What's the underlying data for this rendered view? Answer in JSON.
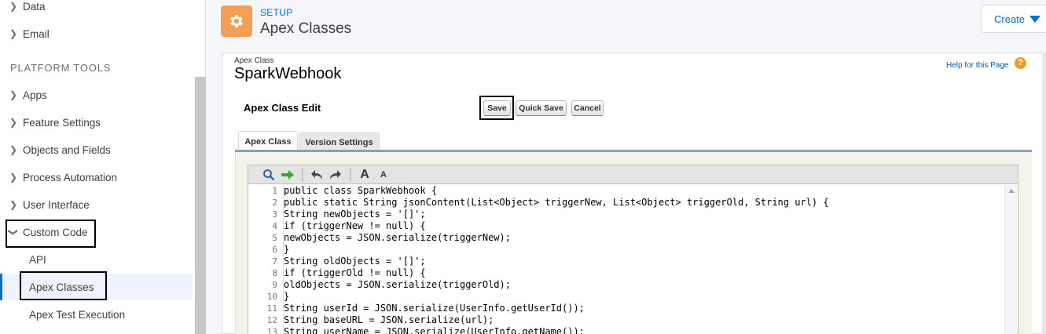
{
  "sidebar": {
    "top_items": [
      {
        "label": "Data"
      },
      {
        "label": "Email"
      }
    ],
    "heading": "PLATFORM TOOLS",
    "items": [
      {
        "label": "Apps"
      },
      {
        "label": "Feature Settings"
      },
      {
        "label": "Objects and Fields"
      },
      {
        "label": "Process Automation"
      },
      {
        "label": "User Interface"
      },
      {
        "label": "Custom Code"
      }
    ],
    "sub_items": [
      {
        "label": "API"
      },
      {
        "label": "Apex Classes"
      },
      {
        "label": "Apex Test Execution"
      }
    ],
    "active_sub": "Apex Classes",
    "icons": {
      "collapsed": "chevron-right-icon",
      "expanded": "chevron-down-icon"
    }
  },
  "header": {
    "breadcrumb": "SETUP",
    "title": "Apex Classes",
    "icon": "gear-icon",
    "icon_color": "#f59e54",
    "create_label": "Create",
    "create_icon": "caret-down-icon"
  },
  "page": {
    "object_label": "Apex Class",
    "class_name": "SparkWebhook",
    "help_link": "Help for this Page",
    "help_icon": "question-circle-icon",
    "edit_title": "Apex Class Edit",
    "buttons": {
      "save": "Save",
      "quick_save": "Quick Save",
      "cancel": "Cancel"
    },
    "tabs": [
      {
        "label": "Apex Class",
        "active": true
      },
      {
        "label": "Version Settings",
        "active": false
      }
    ]
  },
  "editor": {
    "toolbar_icons": [
      "search-icon",
      "go-to-line-icon",
      "undo-icon",
      "redo-icon",
      "font-increase-icon",
      "font-decrease-icon"
    ],
    "toolbar_glyphs": {
      "font_large": "A",
      "font_small": "A"
    },
    "lines": [
      {
        "n": "1",
        "code": "public class SparkWebhook {"
      },
      {
        "n": "2",
        "code": "public static String jsonContent(List<Object> triggerNew, List<Object> triggerOld, String url) {"
      },
      {
        "n": "3",
        "code": "String newObjects = '[]';"
      },
      {
        "n": "4",
        "code": "if (triggerNew != null) {"
      },
      {
        "n": "5",
        "code": "newObjects = JSON.serialize(triggerNew);"
      },
      {
        "n": "6",
        "code": "}"
      },
      {
        "n": "7",
        "code": "String oldObjects = '[]';"
      },
      {
        "n": "8",
        "code": "if (triggerOld != null) {"
      },
      {
        "n": "9",
        "code": "oldObjects = JSON.serialize(triggerOld);"
      },
      {
        "n": "10",
        "code": "}"
      },
      {
        "n": "11",
        "code": "String userId = JSON.serialize(UserInfo.getUserId());"
      },
      {
        "n": "12",
        "code": "String baseURL = JSON.serialize(url);"
      },
      {
        "n": "13",
        "code": "String userName = JSON.serialize(UserInfo.getName());"
      }
    ]
  },
  "colors": {
    "accent": "#0070d2",
    "active_nav_bg": "#eef4ff",
    "help_icon": "#e9a21a",
    "tab_bar": "#8a9ebe"
  }
}
